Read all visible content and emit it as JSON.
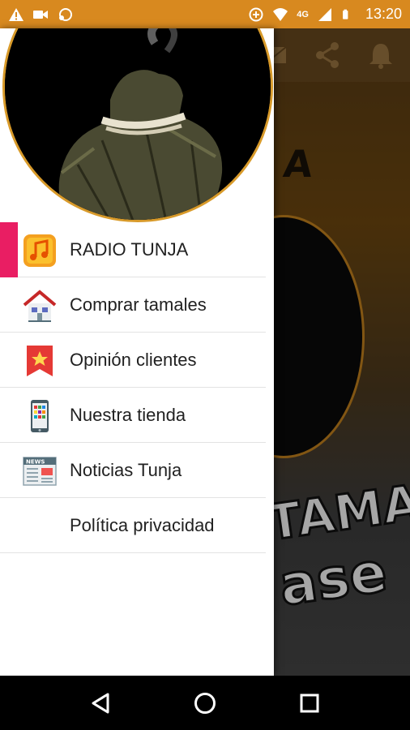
{
  "status_bar": {
    "time": "13:20",
    "network": "4G",
    "icons": [
      "warning-icon",
      "video-icon",
      "cast-icon",
      "data-saver-icon",
      "wifi-icon",
      "signal-icon",
      "battery-icon"
    ]
  },
  "background_app": {
    "toolbar_icons": [
      "mail-icon",
      "share-icon",
      "bell-icon"
    ],
    "banner_text_top": "A",
    "banner_text_middle": "TAMAL",
    "banner_text_bottom": "ase"
  },
  "drawer": {
    "header_image": "tamal-photo",
    "items": [
      {
        "label": "RADIO TUNJA",
        "icon": "music-note-icon",
        "active": true
      },
      {
        "label": "Comprar tamales",
        "icon": "house-icon",
        "active": false
      },
      {
        "label": "Opinión clientes",
        "icon": "star-bookmark-icon",
        "active": false
      },
      {
        "label": "Nuestra tienda",
        "icon": "smartphone-icon",
        "active": false
      },
      {
        "label": "Noticias Tunja",
        "icon": "newspaper-icon",
        "active": false
      },
      {
        "label": "Política privacidad",
        "icon": "",
        "active": false
      }
    ]
  },
  "colors": {
    "status_bar": "#d8891f",
    "active_indicator": "#e91e63",
    "header_ring": "#d89a2a"
  },
  "nav_bar": {
    "buttons": [
      "back-icon",
      "home-icon",
      "recents-icon"
    ]
  }
}
